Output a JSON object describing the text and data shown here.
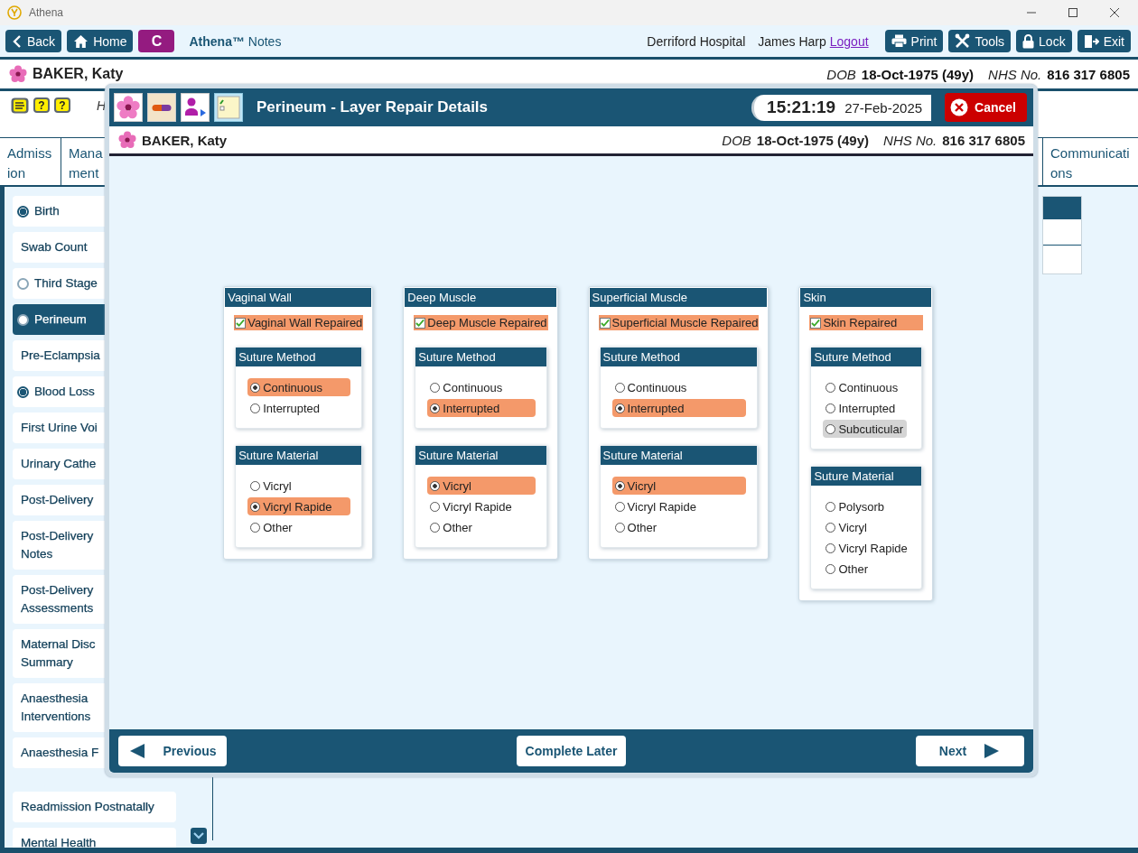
{
  "window": {
    "title": "Athena"
  },
  "toolbar": {
    "left_buttons": [
      {
        "kind": "back",
        "label": "Back"
      },
      {
        "kind": "home",
        "label": "Home"
      },
      {
        "kind": "c",
        "label": "C"
      }
    ],
    "app_name": "**Athena™** Notes",
    "hospital": "Derriford Hospital",
    "user": "James Harp",
    "logout": "Logout",
    "right_buttons": [
      {
        "kind": "print",
        "label": "Print"
      },
      {
        "kind": "tools",
        "label": "Tools"
      },
      {
        "kind": "lock",
        "label": "Lock"
      },
      {
        "kind": "exit",
        "label": "Exit"
      }
    ]
  },
  "patient": {
    "name": "BAKER, Katy",
    "dob_label": "DOB",
    "dob": "18-Oct-1975 (49y)",
    "nhs_label": "NHS No.",
    "nhs": "816 317 6805"
  },
  "alerts": [
    {
      "kind": "hand"
    },
    {
      "kind": "question",
      "symbol": "?"
    },
    {
      "kind": "question",
      "symbol": "?"
    }
  ],
  "alert_note": "H",
  "tabs": [
    {
      "label": "Admission"
    },
    {
      "label": "Mana ment"
    },
    {
      "label": "Communications"
    }
  ],
  "sidebar": {
    "groups": [
      [
        {
          "label": "Birth",
          "kind": "status",
          "complete": true,
          "selected": false
        },
        {
          "label": "Swab Count",
          "kind": "plain",
          "selected": false
        },
        {
          "label": "Third Stage",
          "kind": "status",
          "complete": false,
          "selected": false
        },
        {
          "label": "Perineum",
          "kind": "status",
          "complete": false,
          "selected": true
        },
        {
          "label": "Pre-Eclampsia",
          "kind": "plain",
          "selected": false
        },
        {
          "label": "Blood Loss",
          "kind": "status",
          "complete": true,
          "selected": false
        },
        {
          "label": "First Urine Voi",
          "kind": "plain",
          "selected": false
        },
        {
          "label": "Urinary Cathe",
          "kind": "plain",
          "selected": false
        },
        {
          "label": "Post-Delivery",
          "kind": "plain",
          "selected": false
        },
        {
          "label": "Post-Delivery Notes",
          "kind": "plain",
          "selected": false
        },
        {
          "label": "Post-Delivery Assessments",
          "kind": "plain",
          "selected": false
        },
        {
          "label": "Maternal Disc Summary",
          "kind": "plain",
          "selected": false
        },
        {
          "label": "Anaesthesia Interventions",
          "kind": "plain",
          "selected": false
        },
        {
          "label": "Anaesthesia F",
          "kind": "plain",
          "selected": false
        }
      ],
      [
        {
          "label": "Readmission Postnatally",
          "kind": "plain",
          "selected": false
        },
        {
          "label": "Mental Health",
          "kind": "plain",
          "selected": false
        }
      ]
    ]
  },
  "dialog": {
    "icons": [
      {
        "kind": "flower"
      },
      {
        "kind": "pill"
      },
      {
        "kind": "person"
      },
      {
        "kind": "notepad"
      }
    ],
    "title": "Perineum - Layer Repair Details",
    "time": "15:21:19",
    "date": "27-Feb-2025",
    "cancel": "Cancel",
    "patient": {
      "name": "BAKER, Katy",
      "dob_label": "DOB",
      "dob": "18-Oct-1975 (49y)",
      "nhs_label": "NHS No.",
      "nhs": "816 317 6805"
    },
    "sections": [
      {
        "title": "Vaginal Wall",
        "repaired": {
          "label": "Vaginal Wall Repaired",
          "checked": true
        },
        "groups": [
          {
            "title": "Suture Method",
            "options": [
              {
                "label": "Continuous",
                "selected": true,
                "hovered": false
              },
              {
                "label": "Interrupted",
                "selected": false,
                "hovered": false
              }
            ]
          },
          {
            "title": "Suture Material",
            "options": [
              {
                "label": "Vicryl",
                "selected": false,
                "hovered": false
              },
              {
                "label": "Vicryl Rapide",
                "selected": true,
                "hovered": false
              },
              {
                "label": "Other",
                "selected": false,
                "hovered": false
              }
            ]
          }
        ]
      },
      {
        "title": "Deep Muscle",
        "repaired": {
          "label": "Deep Muscle Repaired",
          "checked": true
        },
        "groups": [
          {
            "title": "Suture Method",
            "options": [
              {
                "label": "Continuous",
                "selected": false,
                "hovered": false
              },
              {
                "label": "Interrupted",
                "selected": true,
                "hovered": false
              }
            ]
          },
          {
            "title": "Suture Material",
            "options": [
              {
                "label": "Vicryl",
                "selected": true,
                "hovered": false
              },
              {
                "label": "Vicryl Rapide",
                "selected": false,
                "hovered": false
              },
              {
                "label": "Other",
                "selected": false,
                "hovered": false
              }
            ]
          }
        ]
      },
      {
        "title": "Superficial Muscle",
        "repaired": {
          "label": "Superficial Muscle Repaired",
          "checked": true
        },
        "groups": [
          {
            "title": "Suture Method",
            "options": [
              {
                "label": "Continuous",
                "selected": false,
                "hovered": false
              },
              {
                "label": "Interrupted",
                "selected": true,
                "hovered": false
              }
            ]
          },
          {
            "title": "Suture Material",
            "options": [
              {
                "label": "Vicryl",
                "selected": true,
                "hovered": false
              },
              {
                "label": "Vicryl Rapide",
                "selected": false,
                "hovered": false
              },
              {
                "label": "Other",
                "selected": false,
                "hovered": false
              }
            ]
          }
        ]
      },
      {
        "title": "Skin",
        "repaired": {
          "label": "Skin Repaired",
          "checked": true
        },
        "groups": [
          {
            "title": "Suture Method",
            "options": [
              {
                "label": "Continuous",
                "selected": false,
                "hovered": false
              },
              {
                "label": "Interrupted",
                "selected": false,
                "hovered": false
              },
              {
                "label": "Subcuticular",
                "selected": false,
                "hovered": true
              }
            ]
          },
          {
            "title": "Suture Material",
            "options": [
              {
                "label": "Polysorb",
                "selected": false,
                "hovered": false
              },
              {
                "label": "Vicryl",
                "selected": false,
                "hovered": false
              },
              {
                "label": "Vicryl Rapide",
                "selected": false,
                "hovered": false
              },
              {
                "label": "Other",
                "selected": false,
                "hovered": false
              }
            ]
          }
        ]
      }
    ],
    "footer": {
      "previous": "Previous",
      "complete_later": "Complete Later",
      "next": "Next"
    }
  }
}
